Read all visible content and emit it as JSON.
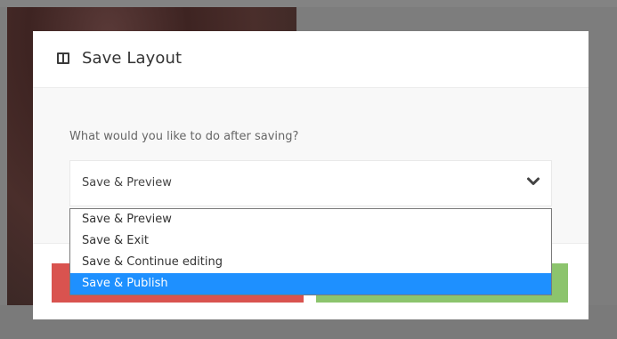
{
  "modal": {
    "title": "Save Layout",
    "question": "What would you like to do after saving?",
    "select": {
      "value": "Save & Preview",
      "options": [
        "Save & Preview",
        "Save & Exit",
        "Save & Continue editing",
        "Save & Publish"
      ],
      "highlighted": "Save & Publish"
    }
  },
  "colors": {
    "highlight": "#1e90ff",
    "danger": "#d9534f",
    "success": "#8cc46d"
  },
  "icons": {
    "title": "layout-columns-icon",
    "select": "chevron-down-icon"
  }
}
